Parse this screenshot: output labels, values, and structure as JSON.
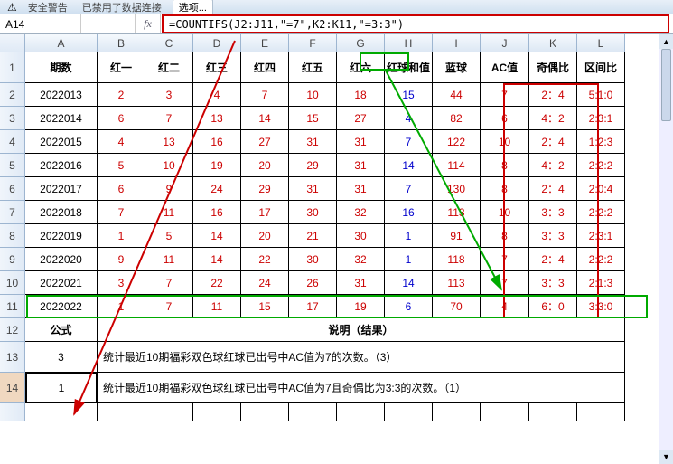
{
  "ribbon": {
    "security": "安全警告",
    "disabled_note": "已禁用了数据连接",
    "option_btn": "选项..."
  },
  "namebox": "A14",
  "formula": "=COUNTIFS(J2:J11,\"=7\",K2:K11,\"=3:3\")",
  "cols": [
    "A",
    "B",
    "C",
    "D",
    "E",
    "F",
    "G",
    "H",
    "I",
    "J",
    "K",
    "L"
  ],
  "rows": [
    "1",
    "2",
    "3",
    "4",
    "5",
    "6",
    "7",
    "8",
    "9",
    "10",
    "11",
    "12",
    "13",
    "14"
  ],
  "header_row": [
    "期数",
    "红一",
    "红二",
    "红三",
    "红四",
    "红五",
    "红六",
    "红球和值",
    "蓝球",
    "AC值",
    "奇偶比",
    "区间比"
  ],
  "data": [
    [
      "2022013",
      "2",
      "3",
      "4",
      "7",
      "10",
      "18",
      "15",
      "44",
      "7",
      "2：4",
      "5:1:0"
    ],
    [
      "2022014",
      "6",
      "7",
      "13",
      "14",
      "15",
      "27",
      "4",
      "82",
      "6",
      "4：2",
      "2:3:1"
    ],
    [
      "2022015",
      "4",
      "13",
      "16",
      "27",
      "31",
      "31",
      "7",
      "122",
      "10",
      "2：4",
      "1:2:3"
    ],
    [
      "2022016",
      "5",
      "10",
      "19",
      "20",
      "29",
      "31",
      "14",
      "114",
      "8",
      "4：2",
      "2:2:2"
    ],
    [
      "2022017",
      "6",
      "9",
      "24",
      "29",
      "31",
      "31",
      "7",
      "130",
      "8",
      "2：4",
      "2:0:4"
    ],
    [
      "2022018",
      "7",
      "11",
      "16",
      "17",
      "30",
      "32",
      "16",
      "113",
      "10",
      "3：3",
      "2:2:2"
    ],
    [
      "2022019",
      "1",
      "5",
      "14",
      "20",
      "21",
      "30",
      "1",
      "91",
      "8",
      "3：3",
      "2:3:1"
    ],
    [
      "2022020",
      "9",
      "11",
      "14",
      "22",
      "30",
      "32",
      "1",
      "118",
      "7",
      "2：4",
      "2:2:2"
    ],
    [
      "2022021",
      "3",
      "7",
      "22",
      "24",
      "26",
      "31",
      "14",
      "113",
      "7",
      "3：3",
      "2:1:3"
    ],
    [
      "2022022",
      "1",
      "7",
      "11",
      "15",
      "17",
      "19",
      "6",
      "70",
      "4",
      "6：0",
      "3:3:0"
    ]
  ],
  "formula_label": "公式",
  "explain_label": "说明（结果）",
  "r13_val": "3",
  "r13_text": "统计最近10期福彩双色球红球已出号中AC值为7的次数。（3）",
  "r14_val": "1",
  "r14_text": "统计最近10期福彩双色球红球已出号中AC值为7且奇偶比为3:3的次数。（1）"
}
